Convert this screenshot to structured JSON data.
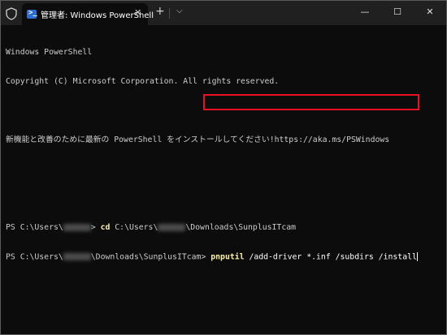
{
  "window": {
    "tab_title": "管理者: Windows PowerShell",
    "tab_icon": "powershell-icon",
    "new_tab": "+",
    "dropdown": "⌵",
    "minimize": "—",
    "maximize": "☐",
    "close": "✕",
    "tab_close": "✕"
  },
  "terminal": {
    "line1": "Windows PowerShell",
    "line2": "Copyright (C) Microsoft Corporation. All rights reserved.",
    "line3": "新機能と改善のために最新の PowerShell をインストールしてください!https://aka.ms/PSWindows",
    "prompt1_pre": "PS C:\\Users\\",
    "prompt1_post": "> ",
    "cmd1_keyword": "cd",
    "cmd1_path_pre": " C:\\Users\\",
    "cmd1_path_post": "\\Downloads\\SunplusITcam",
    "prompt2_pre": "PS C:\\Users\\",
    "prompt2_post": "\\Downloads\\SunplusITcam> ",
    "cmd2_keyword": "pnputil",
    "cmd2_args": " /add-driver *.inf /subdirs /install"
  },
  "colors": {
    "background": "#0c0c0c",
    "highlight": "#e81123",
    "command": "#f9f1a5"
  }
}
